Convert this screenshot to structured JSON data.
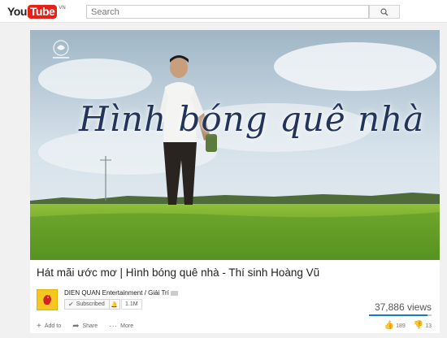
{
  "masthead": {
    "logo_you": "You",
    "logo_tube": "Tube",
    "logo_region": "VN",
    "search_placeholder": "Search",
    "search_icon": "search-icon"
  },
  "player": {
    "overlay_title": "Hình bóng quê nhà",
    "watermark": "channel-logo"
  },
  "video": {
    "title": "Hát mãi ước mơ | Hình bóng quê nhà - Thí sinh Hoàng Vũ",
    "channel": "DIEN QUAN Entertainment / Giải Trí",
    "subscribe_label": "Subscribed",
    "subscriber_count": "1.1M",
    "views": "37,886 views",
    "like_ratio": 0.935,
    "actions": {
      "add_to": "Add to",
      "share": "Share",
      "more": "More"
    },
    "likes": "189",
    "dislikes": "13"
  },
  "colors": {
    "brand_red": "#e62117",
    "accent_blue": "#167ac6",
    "channel_yellow": "#f4c820"
  }
}
